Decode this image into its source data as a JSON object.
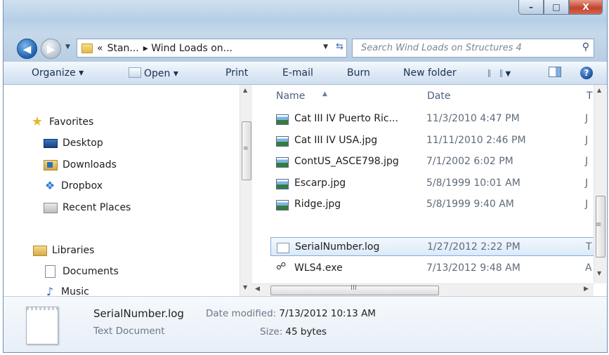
{
  "window": {
    "minimize": "–",
    "maximize": "□",
    "close": "X"
  },
  "address": {
    "overflow": "«",
    "crumbs": [
      "Stan...",
      "▸ Wind Loads on..."
    ],
    "search_placeholder": "Search Wind Loads on Structures 4"
  },
  "toolbar": {
    "organize": "Organize ▾",
    "open": "Open ▾",
    "print": "Print",
    "email": "E-mail",
    "burn": "Burn",
    "new_folder": "New folder",
    "help": "?"
  },
  "nav": {
    "favorites": "Favorites",
    "desktop": "Desktop",
    "downloads": "Downloads",
    "dropbox": "Dropbox",
    "recent": "Recent Places",
    "libraries": "Libraries",
    "documents": "Documents",
    "music": "Music"
  },
  "columns": {
    "name": "Name",
    "date": "Date",
    "type": "T"
  },
  "files": [
    {
      "name": "Cat III IV Puerto Ric...",
      "date": "11/3/2010 4:47 PM",
      "type": "J"
    },
    {
      "name": "Cat III IV USA.jpg",
      "date": "11/11/2010 2:46 PM",
      "type": "J"
    },
    {
      "name": "ContUS_ASCE798.jpg",
      "date": "7/1/2002 6:02 PM",
      "type": "J"
    },
    {
      "name": "Escarp.jpg",
      "date": "5/8/1999 10:01 AM",
      "type": "J"
    },
    {
      "name": "Ridge.jpg",
      "date": "5/8/1999 9:40 AM",
      "type": "J"
    },
    {
      "name": "SerialNumber.log",
      "date": "1/27/2012 2:22 PM",
      "type": "T"
    },
    {
      "name": "WLS4.exe",
      "date": "7/13/2012 9:48 AM",
      "type": "A"
    }
  ],
  "details": {
    "name": "SerialNumber.log",
    "modified_label": "Date modified:",
    "modified_value": "7/13/2012 10:13 AM",
    "type": "Text Document",
    "size_label": "Size:",
    "size_value": "45 bytes"
  },
  "scrollbar": {
    "grip": "≡",
    "hgrip": "III"
  }
}
